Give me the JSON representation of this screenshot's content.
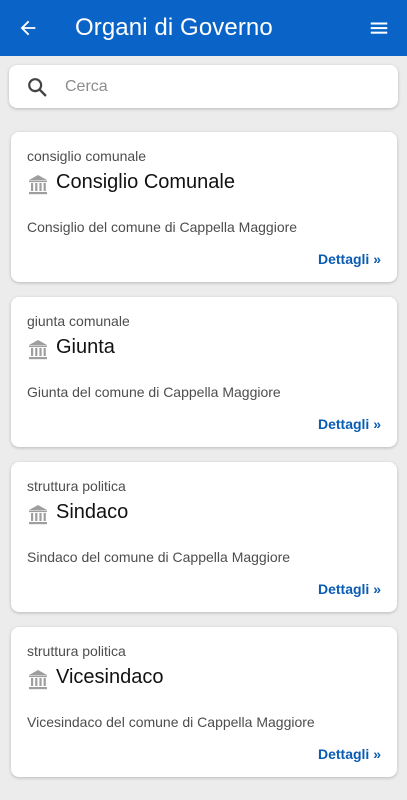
{
  "header": {
    "title": "Organi di Governo",
    "back_icon": "arrow-left-icon",
    "menu_icon": "hamburger-menu-icon",
    "background": "#0a64c8"
  },
  "search": {
    "placeholder": "Cerca",
    "value": "",
    "icon": "search-icon"
  },
  "cards": [
    {
      "type": "consiglio comunale",
      "name": "Consiglio Comunale",
      "description": "Consiglio del comune di Cappella Maggiore",
      "link": "Dettagli »",
      "icon": "bank-icon"
    },
    {
      "type": "giunta comunale",
      "name": "Giunta",
      "description": "Giunta del comune di Cappella Maggiore",
      "link": "Dettagli »",
      "icon": "bank-icon"
    },
    {
      "type": "struttura politica",
      "name": "Sindaco",
      "description": "Sindaco del comune di Cappella Maggiore",
      "link": "Dettagli »",
      "icon": "bank-icon"
    },
    {
      "type": "struttura politica",
      "name": "Vicesindaco",
      "description": "Vicesindaco del comune di Cappella Maggiore",
      "link": "Dettagli »",
      "icon": "bank-icon"
    }
  ],
  "colors": {
    "accent": "#0a64c8",
    "link": "#0a5cb3",
    "page_background": "#ececec"
  }
}
